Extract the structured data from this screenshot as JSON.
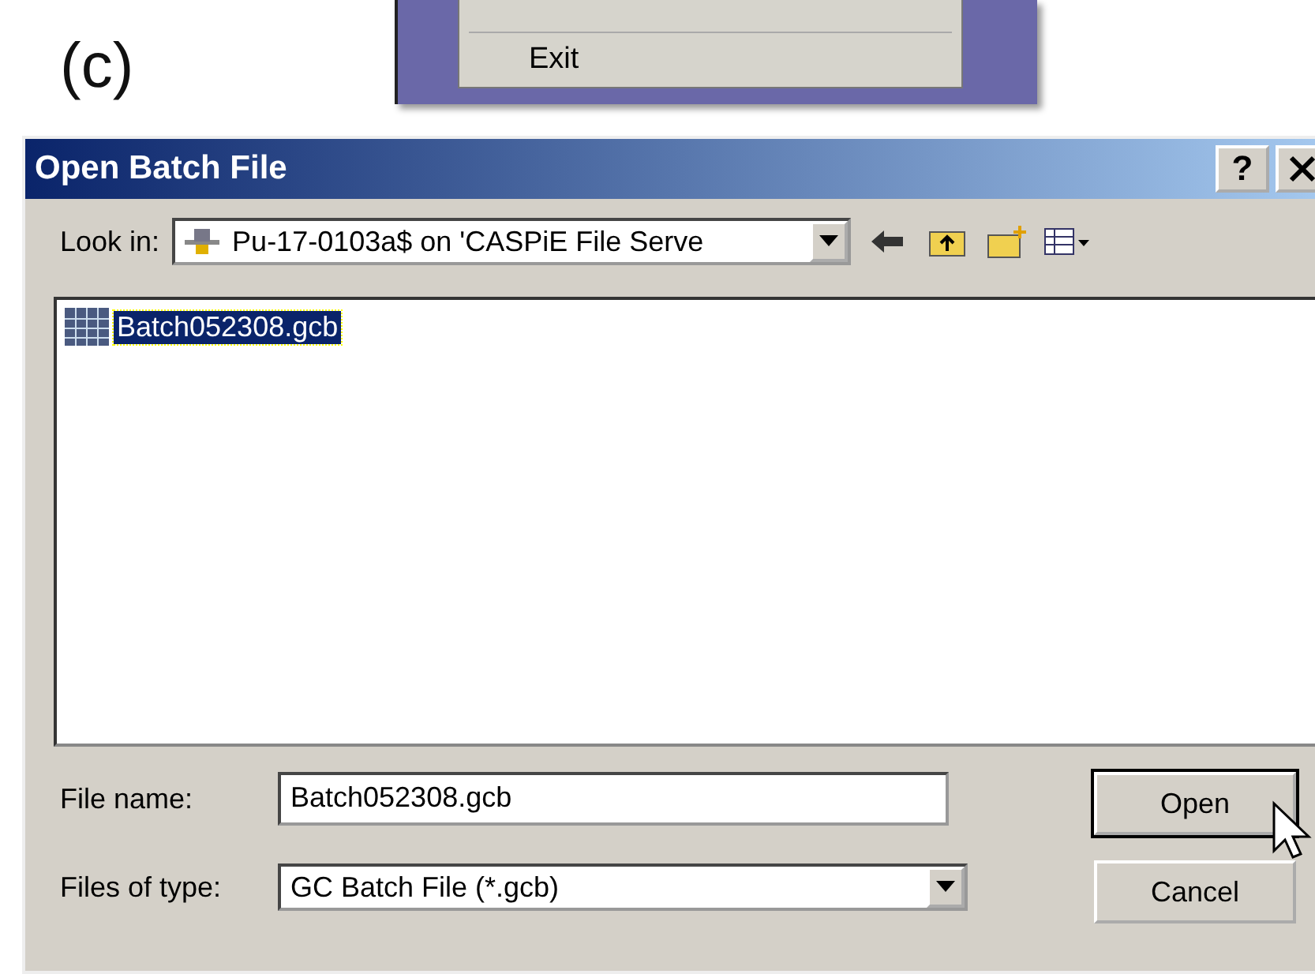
{
  "figure_label": "(c)",
  "menu_fragment": {
    "items": [
      {
        "label": "Exit"
      }
    ]
  },
  "dialog": {
    "title": "Open Batch File",
    "help_button": "?",
    "look_in": {
      "label": "Look in:",
      "value": "Pu-17-0103a$ on 'CASPiE File Serve"
    },
    "files": [
      {
        "name": "Batch052308.gcb",
        "selected": true
      }
    ],
    "file_name": {
      "label": "File name:",
      "value": "Batch052308.gcb"
    },
    "file_type": {
      "label": "Files of type:",
      "value": "GC Batch File (*.gcb)"
    },
    "buttons": [
      {
        "label": "Open",
        "default": true
      },
      {
        "label": "Cancel",
        "default": false
      }
    ]
  }
}
